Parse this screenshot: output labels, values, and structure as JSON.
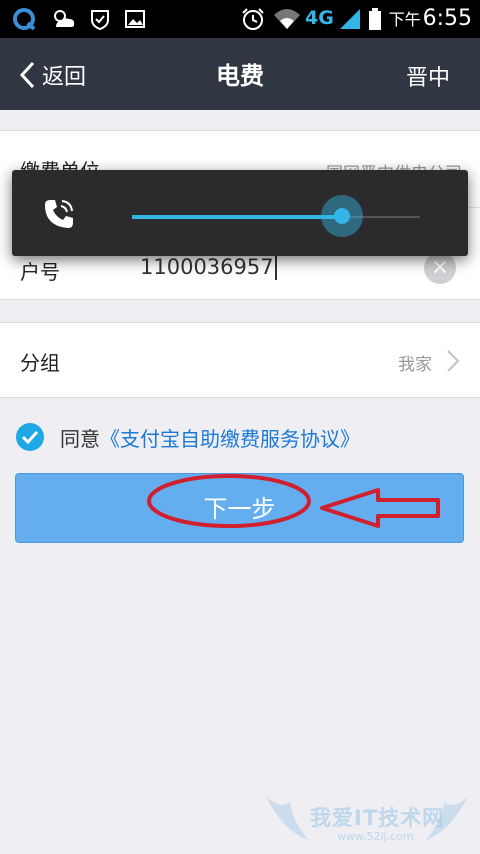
{
  "status_bar": {
    "network": "4G",
    "time_prefix": "下午",
    "time": "6:55"
  },
  "nav": {
    "back_label": "返回",
    "title": "电费",
    "region": "晋中"
  },
  "form": {
    "unit_label": "缴费单位",
    "unit_value": "国网晋中供电公司",
    "account_label": "户号",
    "account_value": "1100036957",
    "group_label": "分组",
    "group_value": "我家"
  },
  "volume_dialog": {
    "icon": "phone-icon",
    "level_percent": 73
  },
  "agreement": {
    "checked": true,
    "prefix": "同意",
    "link": "《支付宝自助缴费服务协议》"
  },
  "next_button": "下一步",
  "watermark": {
    "text": "我爱IT技术网",
    "url": "www.52ij.com"
  },
  "colors": {
    "nav_bg": "#303642",
    "accent": "#33b5e5",
    "button": "#64aef0",
    "link": "#1c7ad6",
    "annotation": "#d0202e"
  }
}
